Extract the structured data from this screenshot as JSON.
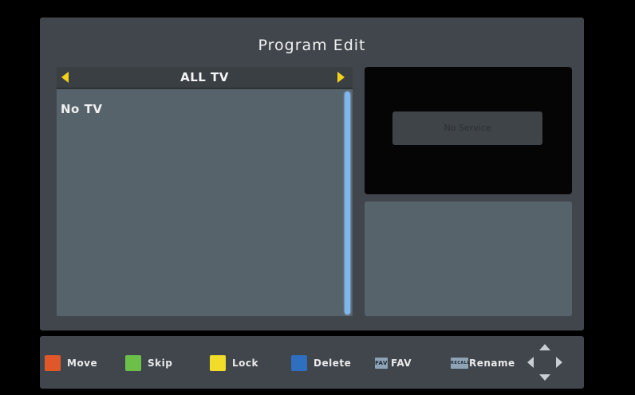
{
  "screen": {
    "title": "Program Edit"
  },
  "channel_list": {
    "group_name": "ALL TV",
    "empty_text": "No TV"
  },
  "preview": {
    "status_text": "No Service"
  },
  "help": {
    "move": {
      "label": "Move",
      "color": "#e0582a"
    },
    "skip": {
      "label": "Skip",
      "color": "#6cc04a"
    },
    "lock": {
      "label": "Lock",
      "color": "#f2dc2a"
    },
    "delete": {
      "label": "Delete",
      "color": "#2f6fc0"
    },
    "fav": {
      "label": "FAV",
      "key": "FAV"
    },
    "rename": {
      "label": "Rename",
      "key": "RECALL"
    },
    "navigate_icon": "dpad-arrows-icon"
  }
}
